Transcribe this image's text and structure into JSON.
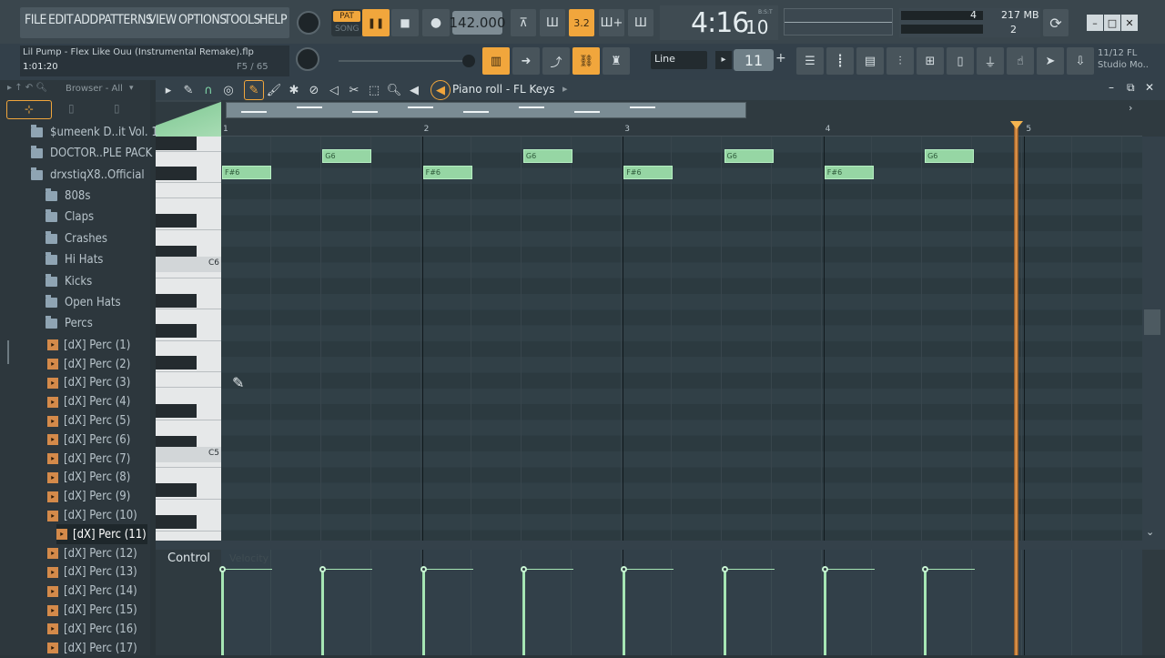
{
  "menu": [
    "FILE",
    "EDIT",
    "ADD",
    "PATTERNS",
    "VIEW",
    "OPTIONS",
    "TOOLS",
    "HELP"
  ],
  "transport": {
    "pat": "PAT",
    "song": "SONG",
    "tempo": "142.000",
    "time_main": "4:16",
    "time_sub": "10",
    "bst": "B:S:T"
  },
  "monitor": {
    "cpu": "4",
    "mem": "217 MB",
    "poly": "2"
  },
  "project": {
    "title": "Lil Pump - Flex Like Ouu (Instrumental Remake).flp",
    "time": "1:01:20",
    "pattern": "F5 / 65"
  },
  "snap": {
    "mode": "Line",
    "value": "11"
  },
  "plugin_news": {
    "a": "11/12",
    "b": "FL",
    "c": "Studio Mo.."
  },
  "browser": {
    "header": "Browser - All",
    "items": [
      {
        "label": "$umeenk D..it Vol. 1",
        "type": "folder",
        "level": 0
      },
      {
        "label": "DOCTOR..PLE PACK",
        "type": "folder",
        "level": 0
      },
      {
        "label": "drxstiqX8..Official",
        "type": "folder",
        "level": 0
      },
      {
        "label": "808s",
        "type": "folder",
        "level": 1
      },
      {
        "label": "Claps",
        "type": "folder",
        "level": 1
      },
      {
        "label": "Crashes",
        "type": "folder",
        "level": 1
      },
      {
        "label": "Hi Hats",
        "type": "folder",
        "level": 1
      },
      {
        "label": "Kicks",
        "type": "folder",
        "level": 1
      },
      {
        "label": "Open Hats",
        "type": "folder",
        "level": 1
      },
      {
        "label": "Percs",
        "type": "folder",
        "level": 1
      },
      {
        "label": "[dX] Perc (1)",
        "type": "file",
        "level": 2
      },
      {
        "label": "[dX] Perc (2)",
        "type": "file",
        "level": 2
      },
      {
        "label": "[dX] Perc (3)",
        "type": "file",
        "level": 2
      },
      {
        "label": "[dX] Perc (4)",
        "type": "file",
        "level": 2
      },
      {
        "label": "[dX] Perc (5)",
        "type": "file",
        "level": 2
      },
      {
        "label": "[dX] Perc (6)",
        "type": "file",
        "level": 2
      },
      {
        "label": "[dX] Perc (7)",
        "type": "file",
        "level": 2
      },
      {
        "label": "[dX] Perc (8)",
        "type": "file",
        "level": 2
      },
      {
        "label": "[dX] Perc (9)",
        "type": "file",
        "level": 2
      },
      {
        "label": "[dX] Perc (10)",
        "type": "file",
        "level": 2
      },
      {
        "label": "[dX] Perc (11)",
        "type": "file",
        "level": 2,
        "selected": true
      },
      {
        "label": "[dX] Perc (12)",
        "type": "file",
        "level": 2
      },
      {
        "label": "[dX] Perc (13)",
        "type": "file",
        "level": 2
      },
      {
        "label": "[dX] Perc (14)",
        "type": "file",
        "level": 2
      },
      {
        "label": "[dX] Perc (15)",
        "type": "file",
        "level": 2
      },
      {
        "label": "[dX] Perc (16)",
        "type": "file",
        "level": 2
      },
      {
        "label": "[dX] Perc (17)",
        "type": "file",
        "level": 2
      }
    ]
  },
  "pianoroll": {
    "title": "Piano roll - FL Keys",
    "ruler": [
      "1",
      "2",
      "3",
      "4",
      "5"
    ],
    "keylabels": [
      "C6",
      "C5"
    ],
    "notes": [
      {
        "pitch": "F#6",
        "beat": 0
      },
      {
        "pitch": "G6",
        "beat": 2
      },
      {
        "pitch": "F#6",
        "beat": 4
      },
      {
        "pitch": "G6",
        "beat": 6
      },
      {
        "pitch": "F#6",
        "beat": 8
      },
      {
        "pitch": "G6",
        "beat": 10
      },
      {
        "pitch": "F#6",
        "beat": 12
      },
      {
        "pitch": "G6",
        "beat": 14
      }
    ],
    "control_label": "Control",
    "control_param": "Velocity"
  }
}
